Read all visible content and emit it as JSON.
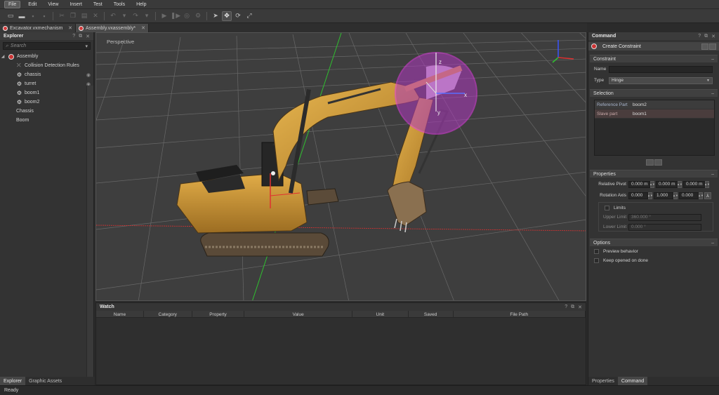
{
  "menubar": {
    "items": [
      "File",
      "Edit",
      "View",
      "Insert",
      "Test",
      "Tools",
      "Help"
    ]
  },
  "toolbar": {
    "icons": [
      "new-file-icon",
      "open-file-icon",
      "save-icon",
      "save-all-icon",
      "undo-icon",
      "redo-icon",
      "pointer-icon",
      "move-icon",
      "rotate-icon"
    ]
  },
  "doc_tabs": [
    {
      "label": "Excavator.vxmechanism"
    },
    {
      "label": "Assembly.vxassembly*"
    }
  ],
  "explorer": {
    "title": "Explorer",
    "search_placeholder": "Search",
    "items": [
      {
        "label": "Assembly"
      },
      {
        "label": "Collision Detection Rules"
      },
      {
        "label": "chassis"
      },
      {
        "label": "turret"
      },
      {
        "label": "boom1"
      },
      {
        "label": "boom2"
      },
      {
        "label": "Chassis"
      },
      {
        "label": "Boom"
      }
    ],
    "tabs": [
      "Explorer",
      "Graphic Assets"
    ]
  },
  "viewport": {
    "label": "Perspective",
    "gizmo_x": "x",
    "gizmo_y": "y",
    "gizmo_z": "z"
  },
  "watch": {
    "title": "Watch",
    "columns": [
      "Name",
      "Category",
      "Property",
      "Value",
      "Unit",
      "Saved",
      "File Path"
    ]
  },
  "command": {
    "title": "Command",
    "subtitle": "Create Constraint",
    "constraint_section": "Constraint",
    "name_label": "Name",
    "name_value": "",
    "type_label": "Type",
    "type_value": "Hinge",
    "selection_section": "Selection",
    "reference_label": "Reference Part",
    "reference_value": "boom2",
    "slave_label": "Slave part",
    "slave_value": "boom1",
    "properties_section": "Properties",
    "pivot_label": "Relative Pivot",
    "pivot": [
      "0.000 m",
      "0.000 m",
      "0.000 m"
    ],
    "axis_label": "Rotation Axis",
    "axis": [
      "0.000",
      "1.000",
      "0.000"
    ],
    "limits_label": "Limits",
    "upper_label": "Upper Limit",
    "upper_value": "360.000 °",
    "lower_label": "Lower Limit",
    "lower_value": "0.000 °",
    "options_section": "Options",
    "preview_label": "Preview behavior",
    "keep_open_label": "Keep opened on done",
    "tabs": [
      "Properties",
      "Command"
    ]
  },
  "status": {
    "text": "Ready"
  },
  "colors": {
    "accent_magenta": "#d23ad6",
    "axis_red": "#e03030",
    "axis_green": "#30c830",
    "excavator_yellow": "#d9a23c"
  }
}
